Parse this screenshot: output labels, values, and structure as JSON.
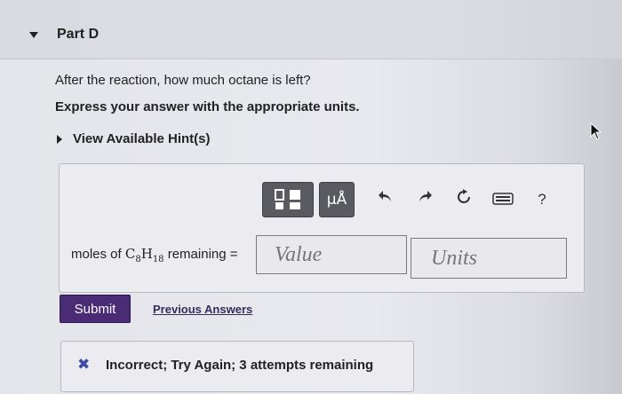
{
  "part": {
    "title": "Part D"
  },
  "question": "After the reaction, how much octane is left?",
  "instruction": "Express your answer with the appropriate units.",
  "hints": {
    "label": "View Available Hint(s)"
  },
  "toolbar": {
    "templates_icon": "templates-icon",
    "mu_label": "μÅ",
    "undo_icon": "undo-icon",
    "redo_icon": "redo-icon",
    "reset_icon": "reset-icon",
    "keyboard_icon": "keyboard-icon",
    "help_label": "?"
  },
  "answer": {
    "label_prefix": "moles of ",
    "formula_c": "C",
    "formula_c_sub": "8",
    "formula_h": "H",
    "formula_h_sub": "18",
    "label_suffix": " remaining =",
    "value_placeholder": "Value",
    "units_placeholder": "Units"
  },
  "actions": {
    "submit_label": "Submit",
    "previous_label": "Previous Answers"
  },
  "feedback": {
    "icon": "✖",
    "text": "Incorrect; Try Again; 3 attempts remaining"
  },
  "colors": {
    "submit": "#4a2b76",
    "incorrect_icon": "#3b4aa8"
  }
}
